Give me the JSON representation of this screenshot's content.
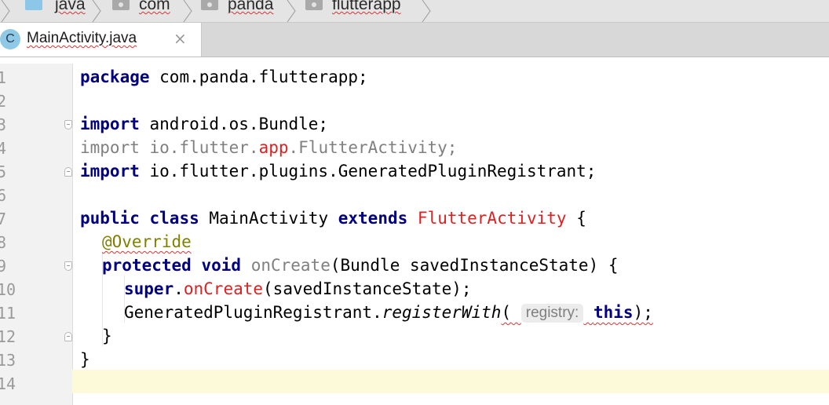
{
  "breadcrumb": [
    "java",
    "com",
    "panda",
    "flutterapp"
  ],
  "tab": {
    "icon_letter": "C",
    "label": "MainActivity.java",
    "close": "×"
  },
  "editor": {
    "line_numbers": [
      "1",
      "2",
      "3",
      "4",
      "5",
      "6",
      "7",
      "8",
      "9",
      "10",
      "11",
      "12",
      "13",
      "14"
    ],
    "current_line": 14,
    "code": {
      "l1": [
        "package",
        " com.panda.flutterapp;"
      ],
      "l3": [
        "import",
        " android.os.Bundle;"
      ],
      "l4": [
        "import",
        " io.flutter.",
        "app",
        ".FlutterActivity;"
      ],
      "l5": [
        "import",
        " io.flutter.plugins.GeneratedPluginRegistrant;"
      ],
      "l7": [
        "public",
        " ",
        "class",
        " MainActivity ",
        "extends",
        " ",
        "FlutterActivity",
        " {"
      ],
      "l8": [
        "@Override"
      ],
      "l9": [
        "protected",
        " ",
        "void",
        " ",
        "onCreate",
        "(Bundle savedInstanceState) {"
      ],
      "l10": [
        "super",
        ".",
        "onCreate",
        "(savedInstanceState);"
      ],
      "l11": [
        "GeneratedPluginRegistrant.",
        "registerWith",
        "( ",
        "registry:",
        " ",
        "this",
        ");"
      ],
      "l12": [
        "}"
      ],
      "l13": [
        "}"
      ]
    }
  }
}
